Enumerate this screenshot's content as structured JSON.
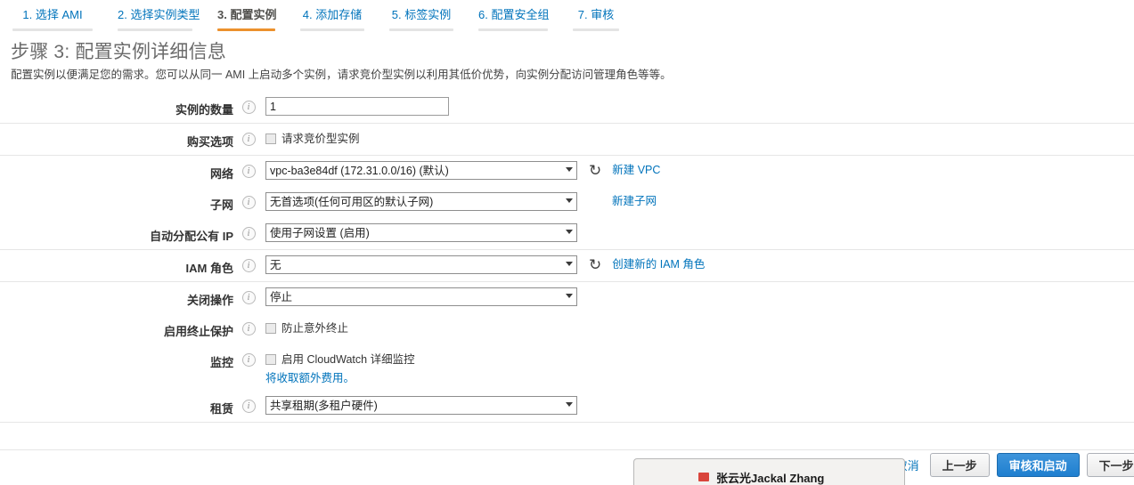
{
  "wizard": {
    "tabs": [
      {
        "label": "1. 选择 AMI",
        "active": false
      },
      {
        "label": "2. 选择实例类型",
        "active": false
      },
      {
        "label": "3. 配置实例",
        "active": true
      },
      {
        "label": "4. 添加存储",
        "active": false
      },
      {
        "label": "5. 标签实例",
        "active": false
      },
      {
        "label": "6. 配置安全组",
        "active": false
      },
      {
        "label": "7. 审核",
        "active": false
      }
    ],
    "accent_color": "#ec912d",
    "link_color": "#0073bb"
  },
  "page": {
    "title": "步骤 3: 配置实例详细信息",
    "description": "配置实例以便满足您的需求。您可以从同一 AMI 上启动多个实例，请求竞价型实例以利用其低价优势，向实例分配访问管理角色等等。"
  },
  "form": {
    "info_icon_glyph": "i",
    "refresh_icon_glyph": "↻",
    "instance_count": {
      "label": "实例的数量",
      "value": "1"
    },
    "purchasing_option": {
      "label": "购买选项",
      "checkbox_label": "请求竞价型实例",
      "checked": false
    },
    "network": {
      "label": "网络",
      "value": "vpc-ba3e84df (172.31.0.0/16) (默认)",
      "link": "新建 VPC"
    },
    "subnet": {
      "label": "子网",
      "value": "无首选项(任何可用区的默认子网)",
      "link": "新建子网"
    },
    "auto_assign_ip": {
      "label": "自动分配公有 IP",
      "value": "使用子网设置 (启用)"
    },
    "iam_role": {
      "label": "IAM 角色",
      "value": "无",
      "link": "创建新的 IAM 角色"
    },
    "shutdown_behavior": {
      "label": "关闭操作",
      "value": "停止"
    },
    "termination_protection": {
      "label": "启用终止保护",
      "checkbox_label": "防止意外终止",
      "checked": false
    },
    "monitoring": {
      "label": "监控",
      "checkbox_label": "启用 CloudWatch 详细监控",
      "checked": false,
      "sub_link": "将收取额外费用。"
    },
    "tenancy": {
      "label": "租赁",
      "value": "共享租期(多租户硬件)"
    }
  },
  "actions": {
    "cancel": "取消",
    "previous": "上一步",
    "review_and_launch": "审核和启动",
    "next": "下一步:"
  },
  "popup": {
    "name": "张云光Jackal Zhang"
  }
}
